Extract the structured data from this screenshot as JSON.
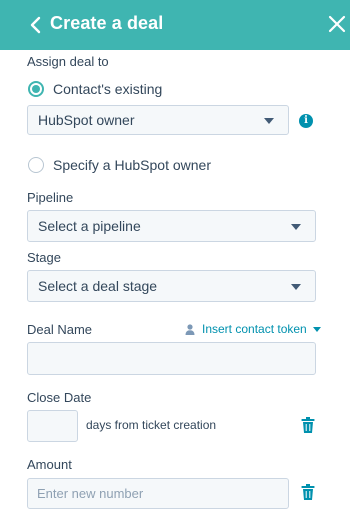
{
  "header": {
    "title": "Create a deal",
    "bg_color": "#3fb5b1"
  },
  "assign": {
    "label": "Assign deal to",
    "option_existing": "Contact's existing",
    "owner_select_value": "HubSpot owner",
    "option_specify": "Specify a HubSpot owner"
  },
  "pipeline": {
    "label": "Pipeline",
    "value": "Select a pipeline"
  },
  "stage": {
    "label": "Stage",
    "value": "Select a deal stage"
  },
  "deal_name": {
    "label": "Deal Name",
    "token_link": "Insert contact token",
    "value": ""
  },
  "close_date": {
    "label": "Close Date",
    "value": "",
    "suffix": "days from ticket creation"
  },
  "amount": {
    "label": "Amount",
    "placeholder": "Enter new number",
    "value": ""
  },
  "accent_color": "#3fb5b1",
  "link_color": "#0091ae"
}
